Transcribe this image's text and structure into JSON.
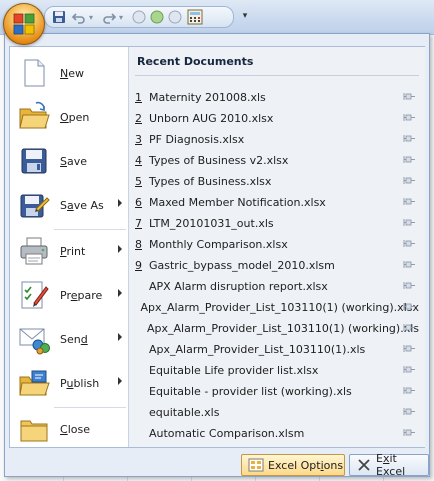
{
  "quick_access": {
    "items": [
      "save-icon",
      "undo-icon",
      "redo-icon",
      "shape-icon",
      "shape-icon",
      "shape-icon",
      "calculator-icon"
    ],
    "customize_glyph": "▾"
  },
  "menu": {
    "commands": [
      {
        "label": "New",
        "accel": "N",
        "icon": "new-document-icon",
        "has_submenu": false
      },
      {
        "label": "Open",
        "accel": "O",
        "icon": "open-folder-icon",
        "has_submenu": false
      },
      {
        "label": "Save",
        "accel": "S",
        "icon": "save-disk-icon",
        "has_submenu": false
      },
      {
        "label": "Save As",
        "accel": "A",
        "icon": "save-as-icon",
        "has_submenu": true
      },
      {
        "label": "Print",
        "accel": "P",
        "icon": "printer-icon",
        "has_submenu": true
      },
      {
        "label": "Prepare",
        "accel": "E",
        "icon": "prepare-icon",
        "has_submenu": true
      },
      {
        "label": "Send",
        "accel": "D",
        "icon": "send-icon",
        "has_submenu": true
      },
      {
        "label": "Publish",
        "accel": "U",
        "icon": "publish-icon",
        "has_submenu": true
      },
      {
        "label": "Close",
        "accel": "C",
        "icon": "close-folder-icon",
        "has_submenu": false
      }
    ],
    "recent_title": "Recent Documents",
    "recent": [
      {
        "num": "1",
        "name": "Maternity 201008.xls"
      },
      {
        "num": "2",
        "name": "Unborn AUG 2010.xlsx"
      },
      {
        "num": "3",
        "name": "PF Diagnosis.xlsx"
      },
      {
        "num": "4",
        "name": "Types of Business v2.xlsx"
      },
      {
        "num": "5",
        "name": "Types of Business.xlsx"
      },
      {
        "num": "6",
        "name": "Maxed Member Notification.xlsx"
      },
      {
        "num": "7",
        "name": "LTM_20101031_out.xls"
      },
      {
        "num": "8",
        "name": "Monthly Comparison.xlsx"
      },
      {
        "num": "9",
        "name": "Gastric_bypass_model_2010.xlsm"
      },
      {
        "num": "",
        "name": "APX Alarm disruption report.xlsx"
      },
      {
        "num": "",
        "name": "Apx_Alarm_Provider_List_103110(1) (working).xlsx"
      },
      {
        "num": "",
        "name": "Apx_Alarm_Provider_List_103110(1) (working).xls"
      },
      {
        "num": "",
        "name": "Apx_Alarm_Provider_List_103110(1).xls"
      },
      {
        "num": "",
        "name": "Equitable Life provider list.xlsx"
      },
      {
        "num": "",
        "name": "Equitable - provider list (working).xls"
      },
      {
        "num": "",
        "name": "equitable.xls"
      },
      {
        "num": "",
        "name": "Automatic Comparison.xlsm"
      }
    ],
    "options_button": "Excel Options",
    "exit_button": "Exit Excel"
  },
  "colors": {
    "menu_bg": "#e7edf6",
    "recent_bg": "#eef1f6",
    "office_orange": "#e58a16",
    "highlight_button": "#fcd98a"
  }
}
